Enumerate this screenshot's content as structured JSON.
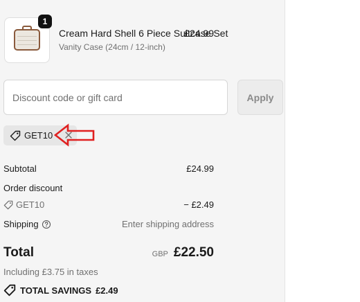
{
  "line_item": {
    "quantity": "1",
    "title": "Cream Hard Shell 6 Piece Suitcase Set",
    "variant": "Vanity Case (24cm / 12-inch)",
    "price": "£24.99",
    "image_icon": "suitcase-thumbnail"
  },
  "discount": {
    "placeholder": "Discount code or gift card",
    "value": "",
    "apply_label": "Apply",
    "applied_code": "GET10",
    "remove_icon": "close-icon",
    "tag_icon": "tag-icon"
  },
  "summary": {
    "subtotal_label": "Subtotal",
    "subtotal_value": "£24.99",
    "order_discount_label": "Order discount",
    "discount_code": "GET10",
    "discount_value": "− £2.49",
    "shipping_label": "Shipping",
    "shipping_value": "Enter shipping address",
    "shipping_help_icon": "help-circle-icon"
  },
  "total": {
    "label": "Total",
    "currency": "GBP",
    "amount": "£22.50",
    "taxes": "Including £3.75 in taxes",
    "savings_label": "TOTAL SAVINGS",
    "savings_value": "£2.49"
  },
  "annotation": {
    "arrow_color": "#e02020",
    "arrow_icon": "left-arrow-annotation"
  },
  "colors": {
    "panel_bg": "#f5f5f5",
    "badge_bg": "#111111",
    "muted_text": "#707070"
  }
}
